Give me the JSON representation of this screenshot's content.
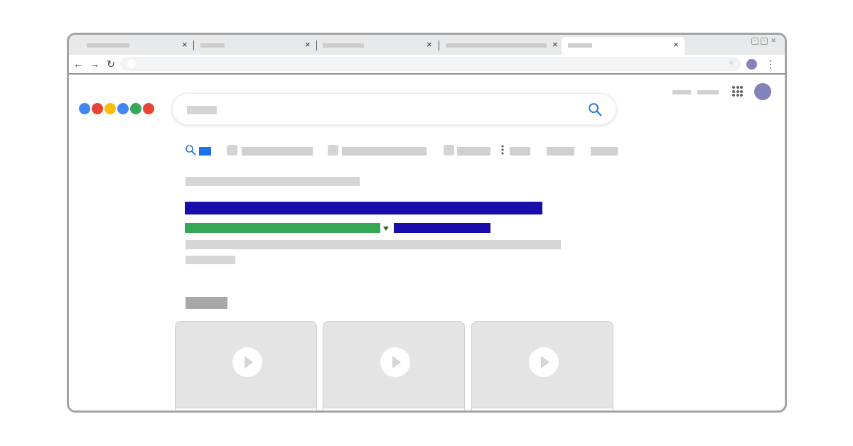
{
  "browser": {
    "tabs": [
      {
        "close": "×"
      },
      {
        "close": "×"
      },
      {
        "close": "×"
      },
      {
        "close": "×"
      },
      {
        "close": "×",
        "active": true
      }
    ],
    "nav": {
      "back": "←",
      "forward": "→",
      "reload": "↻"
    },
    "bookmark_icon": "★",
    "menu_icon": "⋮"
  },
  "logo_colors": [
    "#4285f4",
    "#ea4335",
    "#fbbc05",
    "#4285f4",
    "#34a853",
    "#ea4335"
  ],
  "colors": {
    "accent_blue": "#1a73e8",
    "result_title": "#1a0dab",
    "result_url": "#34a853",
    "avatar": "#8382bb"
  },
  "icons": {
    "search": "search-icon",
    "apps": "apps-grid-icon",
    "more": "more-vert-icon",
    "play": "play-icon"
  }
}
